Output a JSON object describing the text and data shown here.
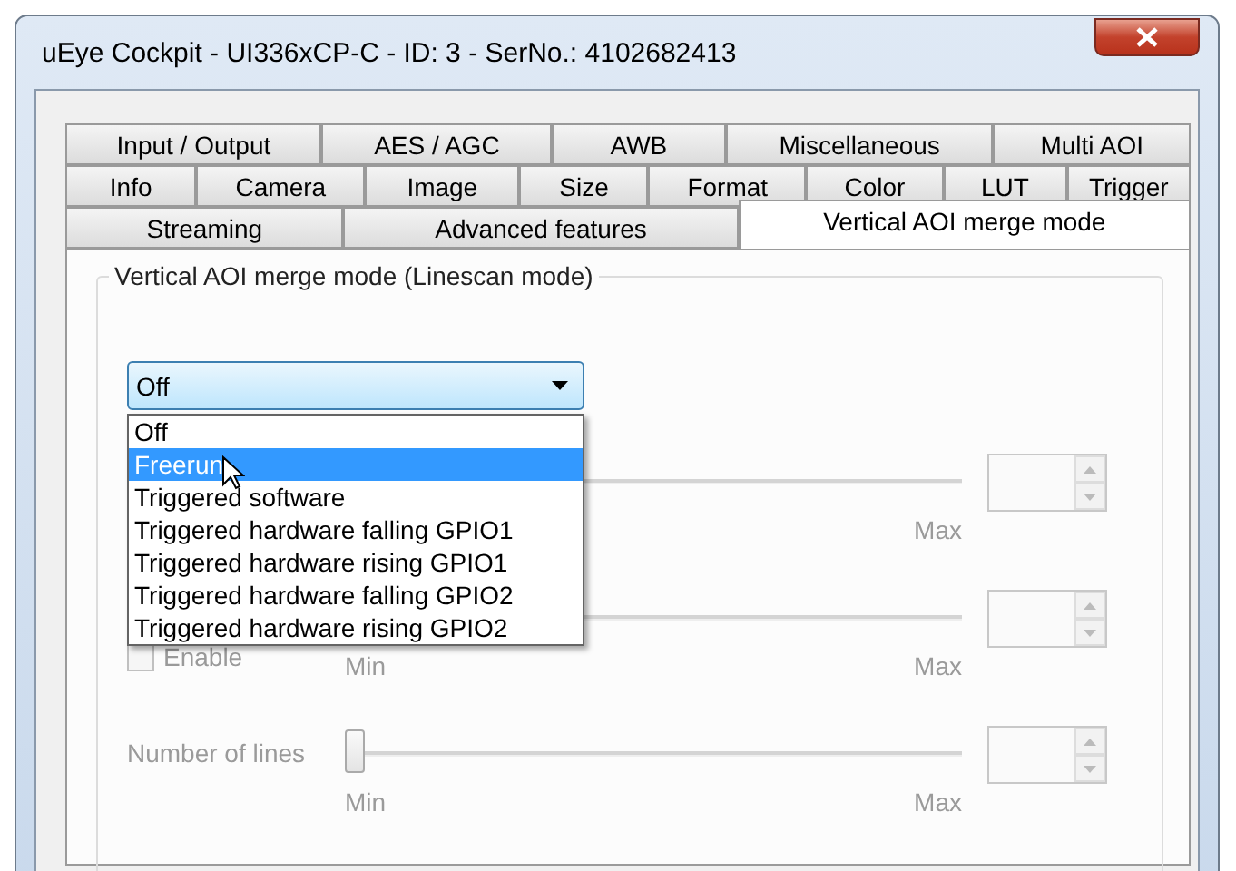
{
  "window": {
    "title": "uEye Cockpit - UI336xCP-C - ID: 3 - SerNo.: 4102682413"
  },
  "tab_rows": [
    [
      {
        "label": "Input / Output",
        "selected": false
      },
      {
        "label": "AES / AGC",
        "selected": false
      },
      {
        "label": "AWB",
        "selected": false
      },
      {
        "label": "Miscellaneous",
        "selected": false
      },
      {
        "label": "Multi AOI",
        "selected": false
      }
    ],
    [
      {
        "label": "Info",
        "selected": false
      },
      {
        "label": "Camera",
        "selected": false
      },
      {
        "label": "Image",
        "selected": false
      },
      {
        "label": "Size",
        "selected": false
      },
      {
        "label": "Format",
        "selected": false
      },
      {
        "label": "Color",
        "selected": false
      },
      {
        "label": "LUT",
        "selected": false
      },
      {
        "label": "Trigger",
        "selected": false
      }
    ],
    [
      {
        "label": "Streaming",
        "selected": false
      },
      {
        "label": "Advanced features",
        "selected": false
      },
      {
        "label": "Vertical AOI merge mode",
        "selected": true
      }
    ]
  ],
  "group": {
    "title": "Vertical AOI merge mode (Linescan mode)",
    "dropdown": {
      "value": "Off",
      "options": [
        {
          "label": "Off",
          "highlighted": false
        },
        {
          "label": "Freerun",
          "highlighted": true
        },
        {
          "label": "Triggered software",
          "highlighted": false
        },
        {
          "label": "Triggered hardware falling GPIO1",
          "highlighted": false
        },
        {
          "label": "Triggered hardware rising GPIO1",
          "highlighted": false
        },
        {
          "label": "Triggered hardware falling GPIO2",
          "highlighted": false
        },
        {
          "label": "Triggered hardware rising GPIO2",
          "highlighted": false
        }
      ]
    },
    "rows": [
      {
        "disabled": true,
        "max": "Max"
      },
      {
        "disabled": true,
        "checkbox": {
          "label": "Enable",
          "checked": false
        },
        "min": "Min",
        "max": "Max"
      },
      {
        "disabled": true,
        "label": "Number of lines",
        "level": 0,
        "min": "Min",
        "max": "Max"
      }
    ]
  }
}
